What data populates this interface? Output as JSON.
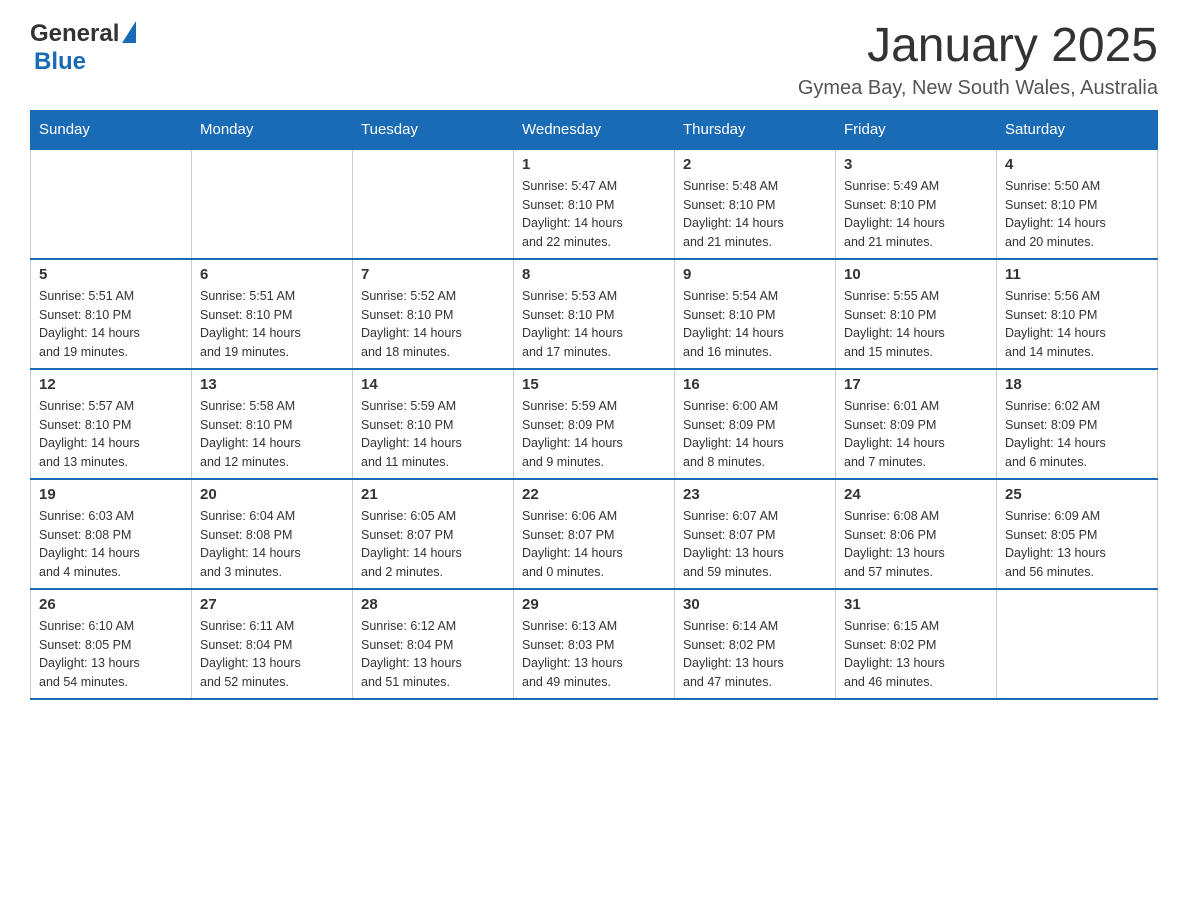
{
  "logo": {
    "general": "General",
    "blue": "Blue"
  },
  "title": "January 2025",
  "subtitle": "Gymea Bay, New South Wales, Australia",
  "days": [
    "Sunday",
    "Monday",
    "Tuesday",
    "Wednesday",
    "Thursday",
    "Friday",
    "Saturday"
  ],
  "weeks": [
    [
      {
        "day": "",
        "info": ""
      },
      {
        "day": "",
        "info": ""
      },
      {
        "day": "",
        "info": ""
      },
      {
        "day": "1",
        "info": "Sunrise: 5:47 AM\nSunset: 8:10 PM\nDaylight: 14 hours\nand 22 minutes."
      },
      {
        "day": "2",
        "info": "Sunrise: 5:48 AM\nSunset: 8:10 PM\nDaylight: 14 hours\nand 21 minutes."
      },
      {
        "day": "3",
        "info": "Sunrise: 5:49 AM\nSunset: 8:10 PM\nDaylight: 14 hours\nand 21 minutes."
      },
      {
        "day": "4",
        "info": "Sunrise: 5:50 AM\nSunset: 8:10 PM\nDaylight: 14 hours\nand 20 minutes."
      }
    ],
    [
      {
        "day": "5",
        "info": "Sunrise: 5:51 AM\nSunset: 8:10 PM\nDaylight: 14 hours\nand 19 minutes."
      },
      {
        "day": "6",
        "info": "Sunrise: 5:51 AM\nSunset: 8:10 PM\nDaylight: 14 hours\nand 19 minutes."
      },
      {
        "day": "7",
        "info": "Sunrise: 5:52 AM\nSunset: 8:10 PM\nDaylight: 14 hours\nand 18 minutes."
      },
      {
        "day": "8",
        "info": "Sunrise: 5:53 AM\nSunset: 8:10 PM\nDaylight: 14 hours\nand 17 minutes."
      },
      {
        "day": "9",
        "info": "Sunrise: 5:54 AM\nSunset: 8:10 PM\nDaylight: 14 hours\nand 16 minutes."
      },
      {
        "day": "10",
        "info": "Sunrise: 5:55 AM\nSunset: 8:10 PM\nDaylight: 14 hours\nand 15 minutes."
      },
      {
        "day": "11",
        "info": "Sunrise: 5:56 AM\nSunset: 8:10 PM\nDaylight: 14 hours\nand 14 minutes."
      }
    ],
    [
      {
        "day": "12",
        "info": "Sunrise: 5:57 AM\nSunset: 8:10 PM\nDaylight: 14 hours\nand 13 minutes."
      },
      {
        "day": "13",
        "info": "Sunrise: 5:58 AM\nSunset: 8:10 PM\nDaylight: 14 hours\nand 12 minutes."
      },
      {
        "day": "14",
        "info": "Sunrise: 5:59 AM\nSunset: 8:10 PM\nDaylight: 14 hours\nand 11 minutes."
      },
      {
        "day": "15",
        "info": "Sunrise: 5:59 AM\nSunset: 8:09 PM\nDaylight: 14 hours\nand 9 minutes."
      },
      {
        "day": "16",
        "info": "Sunrise: 6:00 AM\nSunset: 8:09 PM\nDaylight: 14 hours\nand 8 minutes."
      },
      {
        "day": "17",
        "info": "Sunrise: 6:01 AM\nSunset: 8:09 PM\nDaylight: 14 hours\nand 7 minutes."
      },
      {
        "day": "18",
        "info": "Sunrise: 6:02 AM\nSunset: 8:09 PM\nDaylight: 14 hours\nand 6 minutes."
      }
    ],
    [
      {
        "day": "19",
        "info": "Sunrise: 6:03 AM\nSunset: 8:08 PM\nDaylight: 14 hours\nand 4 minutes."
      },
      {
        "day": "20",
        "info": "Sunrise: 6:04 AM\nSunset: 8:08 PM\nDaylight: 14 hours\nand 3 minutes."
      },
      {
        "day": "21",
        "info": "Sunrise: 6:05 AM\nSunset: 8:07 PM\nDaylight: 14 hours\nand 2 minutes."
      },
      {
        "day": "22",
        "info": "Sunrise: 6:06 AM\nSunset: 8:07 PM\nDaylight: 14 hours\nand 0 minutes."
      },
      {
        "day": "23",
        "info": "Sunrise: 6:07 AM\nSunset: 8:07 PM\nDaylight: 13 hours\nand 59 minutes."
      },
      {
        "day": "24",
        "info": "Sunrise: 6:08 AM\nSunset: 8:06 PM\nDaylight: 13 hours\nand 57 minutes."
      },
      {
        "day": "25",
        "info": "Sunrise: 6:09 AM\nSunset: 8:05 PM\nDaylight: 13 hours\nand 56 minutes."
      }
    ],
    [
      {
        "day": "26",
        "info": "Sunrise: 6:10 AM\nSunset: 8:05 PM\nDaylight: 13 hours\nand 54 minutes."
      },
      {
        "day": "27",
        "info": "Sunrise: 6:11 AM\nSunset: 8:04 PM\nDaylight: 13 hours\nand 52 minutes."
      },
      {
        "day": "28",
        "info": "Sunrise: 6:12 AM\nSunset: 8:04 PM\nDaylight: 13 hours\nand 51 minutes."
      },
      {
        "day": "29",
        "info": "Sunrise: 6:13 AM\nSunset: 8:03 PM\nDaylight: 13 hours\nand 49 minutes."
      },
      {
        "day": "30",
        "info": "Sunrise: 6:14 AM\nSunset: 8:02 PM\nDaylight: 13 hours\nand 47 minutes."
      },
      {
        "day": "31",
        "info": "Sunrise: 6:15 AM\nSunset: 8:02 PM\nDaylight: 13 hours\nand 46 minutes."
      },
      {
        "day": "",
        "info": ""
      }
    ]
  ]
}
